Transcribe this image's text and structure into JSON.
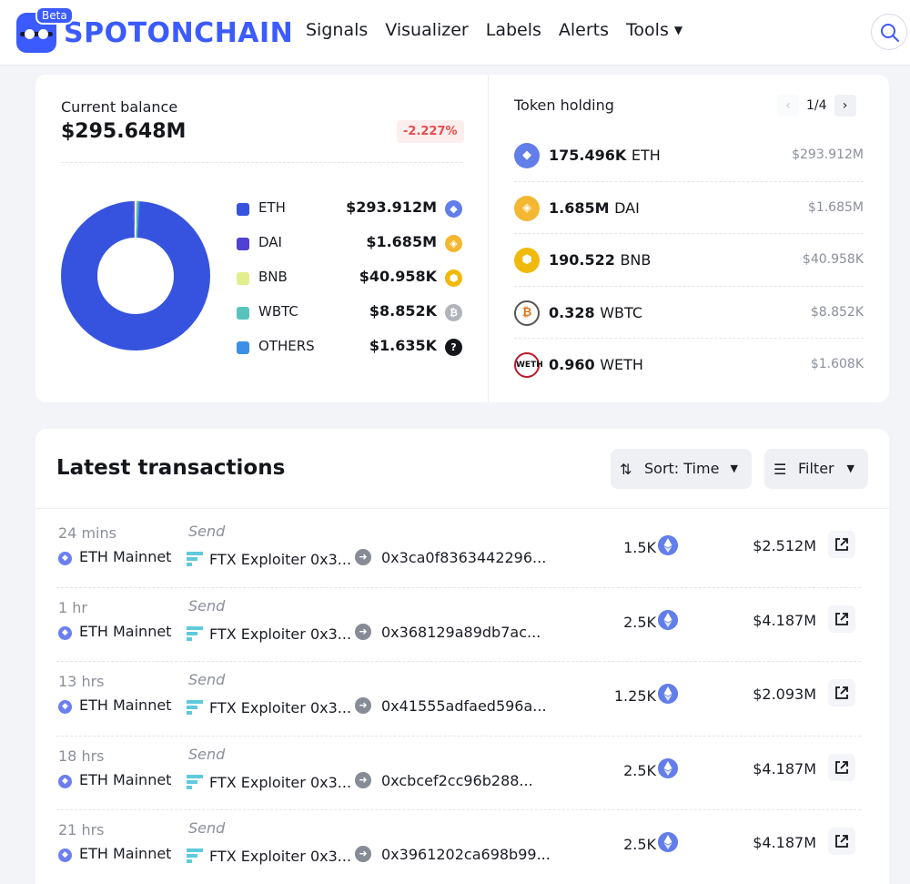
{
  "header": {
    "brand": "SPOTONCHAIN",
    "beta": "Beta",
    "nav": [
      {
        "label": "Signals"
      },
      {
        "label": "Visualizer"
      },
      {
        "label": "Labels"
      },
      {
        "label": "Alerts"
      },
      {
        "label": "Tools"
      }
    ]
  },
  "balance": {
    "label": "Current balance",
    "value": "$295.648M",
    "change": "-2.227%",
    "legend": [
      {
        "name": "ETH",
        "value": "$293.912M",
        "color": "#3653e0",
        "icon": "eth-icon",
        "share": 0.9941
      },
      {
        "name": "DAI",
        "value": "$1.685M",
        "color": "#5140d6",
        "icon": "dai-icon",
        "share": 0.0057
      },
      {
        "name": "BNB",
        "value": "$40.958K",
        "color": "#e3ef8c",
        "icon": "bnb-icon",
        "share": 0.00014
      },
      {
        "name": "WBTC",
        "value": "$8.852K",
        "color": "#56c3bd",
        "icon": "wbtc-icon",
        "share": 3e-05
      },
      {
        "name": "OTHERS",
        "value": "$1.635K",
        "color": "#3b8fe6",
        "icon": "question-icon",
        "share": 1e-05
      }
    ]
  },
  "holding": {
    "label": "Token holding",
    "page": "1/4",
    "items": [
      {
        "amount": "175.496K",
        "symbol": "ETH",
        "usd": "$293.912M",
        "color": "#627eea",
        "icon": "eth-icon"
      },
      {
        "amount": "1.685M",
        "symbol": "DAI",
        "usd": "$1.685M",
        "color": "#f4b731",
        "icon": "dai-icon"
      },
      {
        "amount": "190.522",
        "symbol": "BNB",
        "usd": "$40.958K",
        "color": "#f0b90b",
        "icon": "bnb-icon"
      },
      {
        "amount": "0.328",
        "symbol": "WBTC",
        "usd": "$8.852K",
        "color": "#ffffff",
        "icon": "wbtc-icon"
      },
      {
        "amount": "0.960",
        "symbol": "WETH",
        "usd": "$1.608K",
        "color": "#ffffff",
        "icon": "weth-icon"
      }
    ]
  },
  "transactions": {
    "title": "Latest transactions",
    "sort_label": "Sort: Time",
    "filter_label": "Filter",
    "rows": [
      {
        "time": "24 mins",
        "chain": "ETH Mainnet",
        "type": "Send",
        "from": "FTX Exploiter 0x3...",
        "to": "0x3ca0f8363442296...",
        "amount": "1.5K",
        "usd": "$2.512M"
      },
      {
        "time": "1 hr",
        "chain": "ETH Mainnet",
        "type": "Send",
        "from": "FTX Exploiter 0x3...",
        "to": "0x368129a89db7ac...",
        "amount": "2.5K",
        "usd": "$4.187M"
      },
      {
        "time": "13 hrs",
        "chain": "ETH Mainnet",
        "type": "Send",
        "from": "FTX Exploiter 0x3...",
        "to": "0x41555adfaed596a...",
        "amount": "1.25K",
        "usd": "$2.093M"
      },
      {
        "time": "18 hrs",
        "chain": "ETH Mainnet",
        "type": "Send",
        "from": "FTX Exploiter 0x3...",
        "to": "0xcbcef2cc96b288...",
        "amount": "2.5K",
        "usd": "$4.187M"
      },
      {
        "time": "21 hrs",
        "chain": "ETH Mainnet",
        "type": "Send",
        "from": "FTX Exploiter 0x3...",
        "to": "0x3961202ca698b99...",
        "amount": "2.5K",
        "usd": "$4.187M"
      }
    ]
  }
}
